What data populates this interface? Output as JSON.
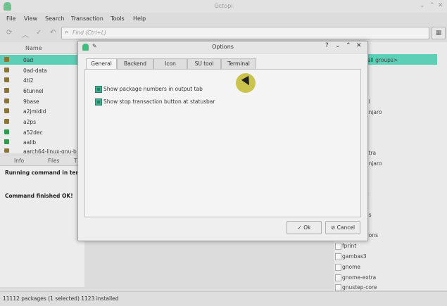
{
  "window": {
    "title": "Octopi"
  },
  "menu": [
    "File",
    "View",
    "Search",
    "Transaction",
    "Tools",
    "Help"
  ],
  "search": {
    "placeholder": "Find  (Ctrl+L)"
  },
  "packages": {
    "header": "Name",
    "rows": [
      {
        "name": "0ad",
        "installed": false,
        "selected": true
      },
      {
        "name": "0ad-data",
        "installed": false,
        "selected": false
      },
      {
        "name": "4ti2",
        "installed": false,
        "selected": false
      },
      {
        "name": "6tunnel",
        "installed": false,
        "selected": false
      },
      {
        "name": "9base",
        "installed": false,
        "selected": false
      },
      {
        "name": "a2jmidid",
        "installed": false,
        "selected": false
      },
      {
        "name": "a2ps",
        "installed": false,
        "selected": false
      },
      {
        "name": "a52dec",
        "installed": true,
        "selected": false
      },
      {
        "name": "aalib",
        "installed": true,
        "selected": false
      },
      {
        "name": "aarch64-linux-gnu-b",
        "installed": false,
        "selected": false
      }
    ]
  },
  "groups": {
    "selected_label": "all groups>",
    "items": [
      "al",
      "anjaro",
      "xtra",
      "anjaro",
      "d",
      "ns",
      "dons",
      "fprint",
      "gambas3",
      "gnome",
      "gnome-extra",
      "gnustep-core"
    ]
  },
  "bottom_tabs": [
    "Info",
    "Files",
    "T"
  ],
  "info": {
    "line1": "Running command in term",
    "line2": "Command finished OK!"
  },
  "status": {
    "text": "11112 packages (1 selected)   1123 installed"
  },
  "dialog": {
    "title": "Options",
    "help": "?",
    "tabs": [
      "General",
      "Backend",
      "Icon",
      "SU tool",
      "Terminal"
    ],
    "active_tab": "General",
    "options": [
      {
        "label": "Show package numbers in output tab",
        "checked": true
      },
      {
        "label": "Show stop transaction button at statusbar",
        "checked": true
      }
    ],
    "ok_label": "Ok",
    "cancel_label": "Cancel"
  }
}
